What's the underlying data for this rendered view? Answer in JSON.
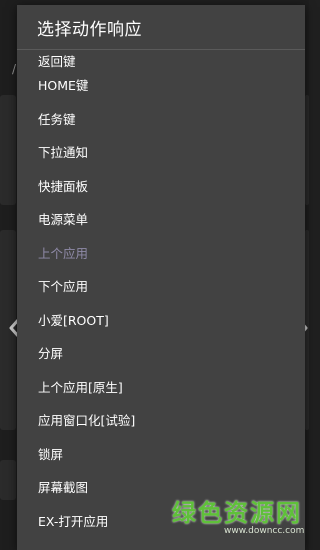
{
  "dialog": {
    "title": "选择动作响应",
    "items": [
      {
        "label": "返回键",
        "disabled": false
      },
      {
        "label": "HOME键",
        "disabled": false
      },
      {
        "label": "任务键",
        "disabled": false
      },
      {
        "label": "下拉通知",
        "disabled": false
      },
      {
        "label": "快捷面板",
        "disabled": false
      },
      {
        "label": "电源菜单",
        "disabled": false
      },
      {
        "label": "上个应用",
        "disabled": true
      },
      {
        "label": "下个应用",
        "disabled": false
      },
      {
        "label": "小爱[ROOT]",
        "disabled": false
      },
      {
        "label": "分屏",
        "disabled": false
      },
      {
        "label": "上个应用[原生]",
        "disabled": false
      },
      {
        "label": "应用窗口化[试验]",
        "disabled": false
      },
      {
        "label": "锁屏",
        "disabled": false
      },
      {
        "label": "屏幕截图",
        "disabled": false
      },
      {
        "label": "EX-打开应用",
        "disabled": false
      }
    ]
  },
  "background": {
    "slash_text": "/"
  },
  "watermark": {
    "text": "绿色资源网",
    "url": "www.downcc.com"
  },
  "icons": {
    "left_arrow": "chevron-left-icon",
    "right_arrow": "chevron-right-icon"
  },
  "colors": {
    "dialog_bg": "#424242",
    "disabled_text": "#8f8aa8",
    "watermark_green": "#5fc03a"
  }
}
